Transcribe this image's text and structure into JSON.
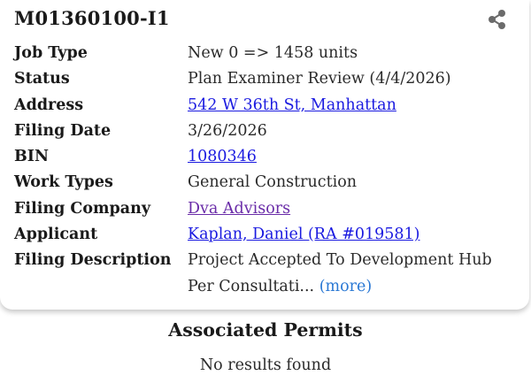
{
  "filing": {
    "job_id": "M01360100-I1"
  },
  "icons": {
    "share": "share-icon"
  },
  "details": [
    {
      "label": "Job Type",
      "value": "New 0 => 1458 units"
    },
    {
      "label": "Status",
      "value": "Plan Examiner Review (4/4/2026)"
    },
    {
      "label": "Address",
      "value": "542 W 36th St, Manhattan"
    },
    {
      "label": "Filing Date",
      "value": "3/26/2026"
    },
    {
      "label": "BIN",
      "value": "1080346"
    },
    {
      "label": "Work Types",
      "value": "General Construction"
    },
    {
      "label": "Filing Company",
      "value": "Dva Advisors"
    },
    {
      "label": "Applicant",
      "value": "Kaplan, Daniel (RA #019581)"
    },
    {
      "label": "Filing Description",
      "value": "Project Accepted To Development Hub Per Consultati...",
      "more_label": "(more)"
    }
  ],
  "associated_permits": {
    "title": "Associated Permits",
    "empty_text": "No results found"
  },
  "colors": {
    "link": "#1a1ae0",
    "visited_link": "#6a2ca8",
    "more_link": "#2a78d4",
    "text": "#1a1a1a"
  }
}
